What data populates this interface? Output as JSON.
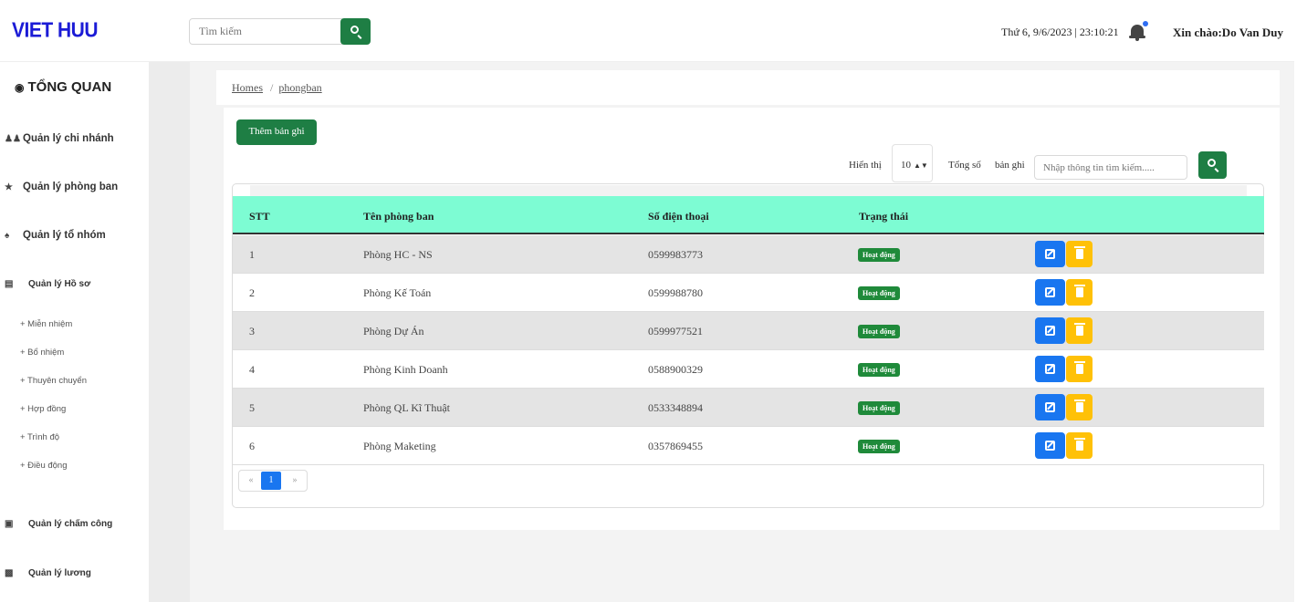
{
  "header": {
    "logo": "VIET HUU",
    "search_placeholder": "Tìm kiếm",
    "datetime": "Thứ 6, 9/6/2023 | 23:10:21",
    "greeting": "Xin chào:Do Van Duy"
  },
  "sidebar": {
    "title": "TỔNG QUAN",
    "items": [
      {
        "label": "Quản lý chi nhánh",
        "icon": "users-cog-icon"
      },
      {
        "label": "Quản lý phòng ban",
        "icon": "users-icon"
      },
      {
        "label": "Quản lý tổ nhóm",
        "icon": "user-group-icon"
      },
      {
        "label": "Quản lý Hồ sơ",
        "icon": "id-card-icon"
      },
      {
        "label": "Quản lý chấm công",
        "icon": "calendar-icon"
      },
      {
        "label": "Quản lý lương",
        "icon": "money-icon"
      }
    ],
    "sub_items": [
      "+ Miễn nhiệm",
      "+ Bổ nhiệm",
      "+ Thuyên chuyển",
      "+ Hợp đồng",
      "+ Trình độ",
      "+ Điều động"
    ]
  },
  "breadcrumb": {
    "home": "Homes",
    "current": "phongban"
  },
  "toolbar": {
    "add_label": "Thêm bản ghi",
    "show_label": "Hiển thị",
    "page_size": "10",
    "total_label": "Tổng số",
    "records_label": "bản ghi",
    "search_placeholder": "Nhập thông tin tìm kiếm....."
  },
  "table": {
    "columns": [
      "STT",
      "Tên phòng ban",
      "Số điện thoại",
      "Trạng thái"
    ],
    "rows": [
      {
        "stt": "1",
        "name": "Phòng HC - NS",
        "phone": "0599983773",
        "status": "Hoạt động"
      },
      {
        "stt": "2",
        "name": "Phòng Kế Toán",
        "phone": "0599988780",
        "status": "Hoạt động"
      },
      {
        "stt": "3",
        "name": "Phòng Dự Án",
        "phone": "0599977521",
        "status": "Hoạt động"
      },
      {
        "stt": "4",
        "name": "Phòng Kinh Doanh",
        "phone": "0588900329",
        "status": "Hoạt động"
      },
      {
        "stt": "5",
        "name": "Phòng QL Kĩ Thuật",
        "phone": "0533348894",
        "status": "Hoạt động"
      },
      {
        "stt": "6",
        "name": "Phòng Maketing",
        "phone": "0357869455",
        "status": "Hoạt động"
      }
    ]
  },
  "pagination": {
    "prev": "«",
    "current": "1",
    "next": "»"
  },
  "colors": {
    "primary_green": "#1e7e44",
    "header_row": "#7dfcd3",
    "edit_blue": "#1976f0",
    "delete_yellow": "#ffc107",
    "logo_blue": "#1b1bd6"
  }
}
